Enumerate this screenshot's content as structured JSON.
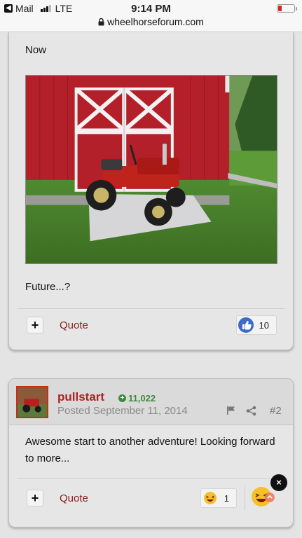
{
  "status_bar": {
    "back_app": "Mail",
    "network": "LTE",
    "time": "9:14 PM",
    "url": "wheelhorseforum.com"
  },
  "post1": {
    "text_before": "Now",
    "text_after": "Future...?",
    "quote_label": "Quote",
    "plus_label": "+",
    "reaction": {
      "icon": "thumbs-up-icon",
      "count": "10",
      "color": "#3d6ac7"
    }
  },
  "post2": {
    "username": "pullstart",
    "reputation": "11,022",
    "posted": "Posted September 11, 2014",
    "post_number": "#2",
    "body": "Awesome start to another adventure!  Looking forward to more...",
    "quote_label": "Quote",
    "plus_label": "+",
    "reaction": {
      "icon": "laughing-emoji-icon",
      "count": "1"
    },
    "colors": {
      "username": "#b02222",
      "reputation": "#3c8a3c",
      "link": "#8a1c1c"
    }
  },
  "overlay": {
    "close_label": "×"
  }
}
